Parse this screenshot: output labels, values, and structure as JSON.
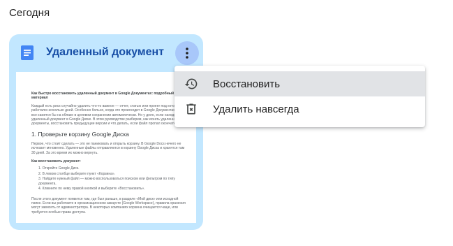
{
  "section": {
    "title": "Сегодня"
  },
  "card": {
    "title": "Удаленный документ",
    "icon": "google-docs-icon",
    "more_icon": "more-vert-icon",
    "accent_color": "#c2e7ff",
    "preview": {
      "title": "Как быстро восстановить удаленный документ в Google Документах: подробный материал",
      "para1": "Каждый есть риск случайно удалить что-то важное — отчет, статью или проект под которым работали несколько дней. Особенно больно, когда это происходит в Google Документах, где все кажется бы на облаке в целевом сохранении автоматически. Но у дело, если находите удаленный документ в Google Диске. В этом руководстве разберем, как искать удаленные документы, восстановить предыдущие версии и что делать, если файл пропал окончательно.",
      "heading": "1. Проверьте корзину Google Диска",
      "para2": "Первое, что стоит сделать — это не паниковать и открыть корзину. В Google Docs нечего не исчезает мгновенно. Удаленные файлы отправляются в корзину Google Диска и хранятся там 30 дней. За это время их можно вернуть.",
      "steps_title": "Как восстановить документ:",
      "steps": [
        "Откройте Google Диск.",
        "В левом столбце выберите пункт «Корзина».",
        "Найдите нужный файл — можно воспользоваться поиском или фильтром по типу документа.",
        "Кликните по нему правой кнопкой и выберите «Восстановить»."
      ],
      "para3": "После этого документ появится там, где был раньше, в разделе «Мой диск» или исходной папке. Если вы работаете в организационном аккаунте (Google Workspace), правила хранения могут зависеть от администратора. В некоторых компаниях корзина очищается чаще, или требуется особые права доступа."
    }
  },
  "menu": {
    "items": [
      {
        "label": "Восстановить",
        "icon": "restore-history-icon"
      },
      {
        "label": "Удалить навсегда",
        "icon": "delete-forever-icon"
      }
    ]
  }
}
